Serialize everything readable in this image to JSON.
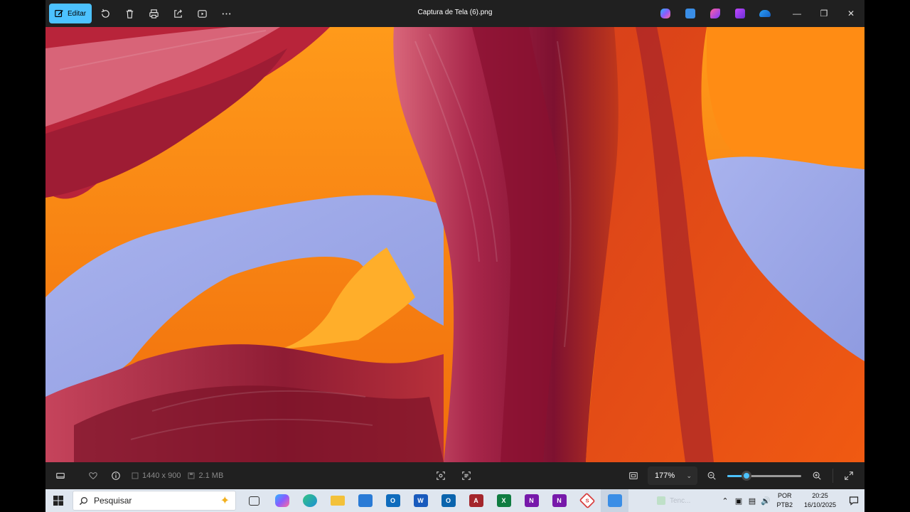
{
  "toolbar": {
    "edit_label": "Editar",
    "icons": [
      "rotate-icon",
      "delete-icon",
      "print-icon",
      "share-icon",
      "slideshow-icon",
      "more-icon"
    ]
  },
  "window": {
    "title": "Captura de Tela (6).png",
    "app_icons": [
      "copilot-icon",
      "photos-icon",
      "clipchamp-icon",
      "designer-icon",
      "onedrive-icon"
    ],
    "controls": [
      "minimize",
      "restore",
      "close"
    ]
  },
  "image": {
    "description_colors": {
      "sky": "#9aa6e6",
      "rock_orange": "#f28a10",
      "rock_red": "#b8241c",
      "rock_pink": "#d45e70"
    }
  },
  "statusbar": {
    "dimensions": "1440 x 900",
    "file_size": "2.1 MB",
    "zoom_value": "177%",
    "zoom_slider_fraction": 0.26
  },
  "taskbar": {
    "search_placeholder": "Pesquisar",
    "ghost_label": "Tenc...",
    "language_line1": "POR",
    "language_line2": "PTB2",
    "time": "20:25",
    "date": "16/10/2025",
    "apps": [
      {
        "name": "task-view",
        "color": "#333333",
        "label": ""
      },
      {
        "name": "copilot",
        "color": "#7b61ff",
        "label": ""
      },
      {
        "name": "edge",
        "color": "#1d8fd6",
        "label": ""
      },
      {
        "name": "file-explorer",
        "color": "#f3c13a",
        "label": ""
      },
      {
        "name": "microsoft-store",
        "color": "#2a7bd6",
        "label": ""
      },
      {
        "name": "outlook",
        "color": "#0f6cbd",
        "label": "O"
      },
      {
        "name": "word",
        "color": "#185abd",
        "label": "W"
      },
      {
        "name": "outlook-classic",
        "color": "#0a64ad",
        "label": "O"
      },
      {
        "name": "access",
        "color": "#a4262c",
        "label": "A"
      },
      {
        "name": "excel",
        "color": "#107c41",
        "label": "X"
      },
      {
        "name": "onenote",
        "color": "#7719aa",
        "label": "N"
      },
      {
        "name": "onenote-2",
        "color": "#7719aa",
        "label": "N"
      },
      {
        "name": "app-s",
        "color": "#d83b3b",
        "label": "S"
      },
      {
        "name": "photos",
        "color": "#3a8ee6",
        "label": ""
      }
    ]
  },
  "accent": "#4cc2ff"
}
